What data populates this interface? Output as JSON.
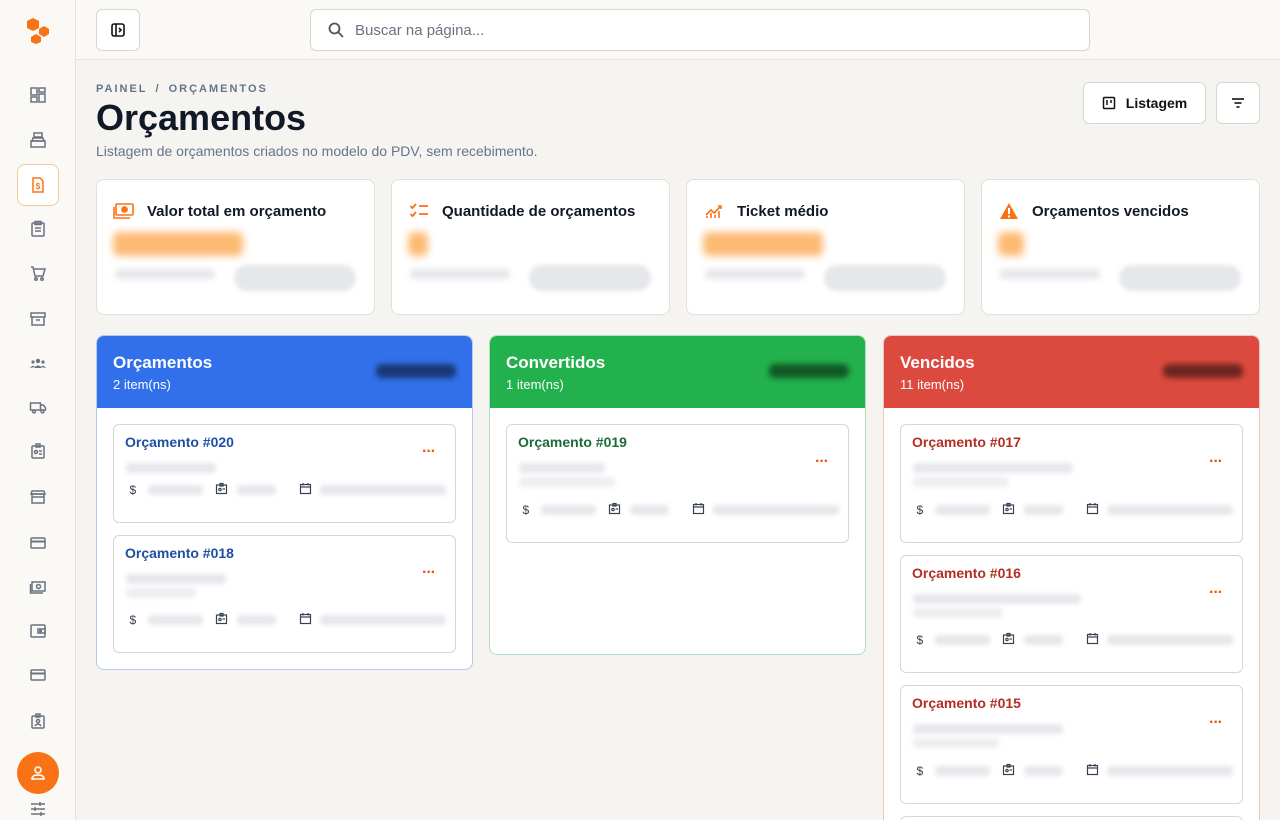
{
  "search": {
    "placeholder": "Buscar na página..."
  },
  "breadcrumb": {
    "root": "PAINEL",
    "separator": "/",
    "current": "ORÇAMENTOS"
  },
  "header": {
    "title": "Orçamentos",
    "subtitle": "Listagem de orçamentos criados no modelo do PDV, sem recebimento.",
    "list_button": "Listagem"
  },
  "kpis": [
    {
      "title": "Valor total em orçamento",
      "icon": "money-icon"
    },
    {
      "title": "Quantidade de orçamentos",
      "icon": "checklist-icon"
    },
    {
      "title": "Ticket médio",
      "icon": "trend-chart-icon"
    },
    {
      "title": "Orçamentos vencidos",
      "icon": "warning-icon"
    }
  ],
  "columns": [
    {
      "title": "Orçamentos",
      "count": "2 item(ns)",
      "color": "#3170ea",
      "accent": "#1e4fa3",
      "cards": [
        {
          "title": "Orçamento #020"
        },
        {
          "title": "Orçamento #018"
        }
      ]
    },
    {
      "title": "Convertidos",
      "count": "1 item(ns)",
      "color": "#22b14c",
      "accent": "#1d6b39",
      "cards": [
        {
          "title": "Orçamento #019"
        }
      ]
    },
    {
      "title": "Vencidos",
      "count": "11 item(ns)",
      "color": "#dc4a3f",
      "accent": "#b32d24",
      "cards": [
        {
          "title": "Orçamento #017"
        },
        {
          "title": "Orçamento #016"
        },
        {
          "title": "Orçamento #015"
        }
      ]
    }
  ],
  "card_meta_icons": [
    "dollar-icon",
    "id-badge-icon",
    "calendar-icon"
  ],
  "card_meta_glyphs": {
    "dollar": "$"
  },
  "card_menu_glyph": "···",
  "colors": {
    "accent": "#f97316",
    "orange_text": "#ea580c"
  }
}
